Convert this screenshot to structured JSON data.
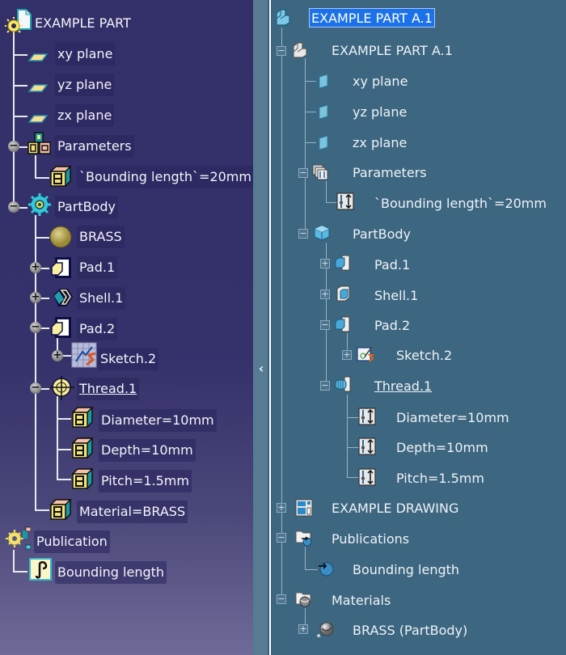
{
  "left_tree": {
    "root": {
      "label": "EXAMPLE PART",
      "icon": "part-document-icon"
    },
    "items": [
      {
        "label": "xy plane",
        "icon": "plane-icon"
      },
      {
        "label": "yz plane",
        "icon": "plane-icon"
      },
      {
        "label": "zx plane",
        "icon": "plane-icon"
      },
      {
        "label": "Parameters",
        "icon": "parameters-icon",
        "toggle": "−"
      },
      {
        "label": "`Bounding length`=20mm",
        "icon": "parameter-icon"
      },
      {
        "label": "PartBody",
        "icon": "partbody-gear-icon",
        "toggle": "−"
      },
      {
        "label": "BRASS",
        "icon": "material-sphere-icon"
      },
      {
        "label": "Pad.1",
        "icon": "pad-icon",
        "toggle": "+"
      },
      {
        "label": "Shell.1",
        "icon": "shell-icon",
        "toggle": "+"
      },
      {
        "label": "Pad.2",
        "icon": "pad-icon",
        "toggle": "−"
      },
      {
        "label": "Sketch.2",
        "icon": "sketch-icon",
        "toggle": "+"
      },
      {
        "label": "Thread.1",
        "icon": "thread-icon",
        "toggle": "−"
      },
      {
        "label": "Diameter=10mm",
        "icon": "parameter-icon"
      },
      {
        "label": "Depth=10mm",
        "icon": "parameter-icon"
      },
      {
        "label": "Pitch=1.5mm",
        "icon": "parameter-icon"
      },
      {
        "label": "Material=BRASS",
        "icon": "parameter-icon"
      },
      {
        "label": "Publication",
        "icon": "publication-icon"
      },
      {
        "label": "Bounding length",
        "icon": "published-parameter-icon"
      }
    ]
  },
  "divider": {
    "collapse_icon": "‹"
  },
  "right_tree": {
    "root": {
      "label": "EXAMPLE PART A.1",
      "icon": "product-icon",
      "selected": true
    },
    "items": [
      {
        "label": "EXAMPLE PART A.1",
        "icon": "part-icon",
        "toggle": "−"
      },
      {
        "label": "xy plane",
        "icon": "plane-icon"
      },
      {
        "label": "yz plane",
        "icon": "plane-icon"
      },
      {
        "label": "zx plane",
        "icon": "plane-icon"
      },
      {
        "label": "Parameters",
        "icon": "parameters-icon",
        "toggle": "−"
      },
      {
        "label": "`Bounding length`=20mm",
        "icon": "parameter-icon"
      },
      {
        "label": "PartBody",
        "icon": "partbody-cube-icon",
        "toggle": "−"
      },
      {
        "label": "Pad.1",
        "icon": "pad-icon",
        "toggle": "+"
      },
      {
        "label": "Shell.1",
        "icon": "shell-icon",
        "toggle": "+"
      },
      {
        "label": "Pad.2",
        "icon": "pad-icon",
        "toggle": "−"
      },
      {
        "label": "Sketch.2",
        "icon": "sketch-icon",
        "toggle": "+"
      },
      {
        "label": "Thread.1",
        "icon": "thread-icon",
        "toggle": "−"
      },
      {
        "label": "Diameter=10mm",
        "icon": "parameter-icon"
      },
      {
        "label": "Depth=10mm",
        "icon": "parameter-icon"
      },
      {
        "label": "Pitch=1.5mm",
        "icon": "parameter-icon"
      },
      {
        "label": "EXAMPLE DRAWING",
        "icon": "drawing-icon",
        "toggle": "+"
      },
      {
        "label": "Publications",
        "icon": "publications-folder-icon",
        "toggle": "−"
      },
      {
        "label": "Bounding length",
        "icon": "publication-icon"
      },
      {
        "label": "Materials",
        "icon": "materials-folder-icon",
        "toggle": "−"
      },
      {
        "label": "BRASS (PartBody)",
        "icon": "material-icon",
        "toggle": "+"
      }
    ]
  },
  "colors": {
    "left_bg_top": "#332f68",
    "left_bg_bottom": "#6f6b98",
    "right_bg": "#3d6680",
    "divider": "#567b93",
    "selection": "#1b72e8"
  }
}
